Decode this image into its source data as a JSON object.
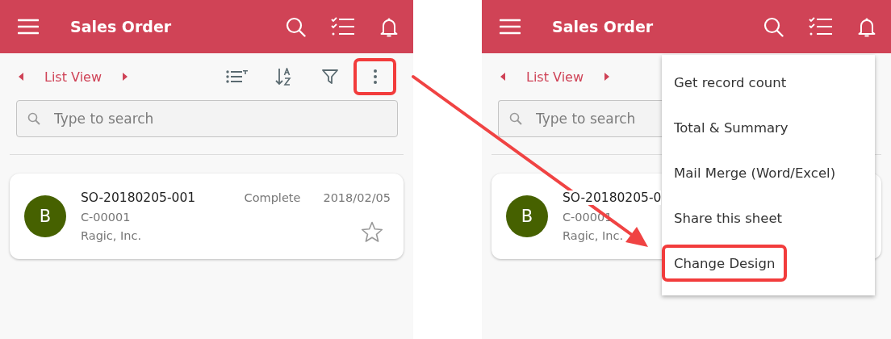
{
  "screens": [
    {
      "header": {
        "title": "Sales Order"
      },
      "view": {
        "label": "List View"
      },
      "more_button": {
        "highlighted": true
      },
      "search": {
        "placeholder": "Type to search"
      },
      "records": [
        {
          "avatar": "B",
          "title": "SO-20180205-001",
          "status": "Complete",
          "date": "2018/02/05",
          "customer_id": "C-00001",
          "company": "Ragic, Inc.",
          "starred": false
        }
      ]
    },
    {
      "header": {
        "title": "Sales Order"
      },
      "view": {
        "label": "List View"
      },
      "search": {
        "placeholder": "Type to search"
      },
      "records": [
        {
          "avatar": "B",
          "title": "SO-20180205-0",
          "customer_id": "C-00001",
          "company": "Ragic, Inc."
        }
      ],
      "menu": {
        "items": [
          {
            "label": "Get record count",
            "highlighted": false
          },
          {
            "label": "Total & Summary",
            "highlighted": false
          },
          {
            "label": "Mail Merge (Word/Excel)",
            "highlighted": false
          },
          {
            "label": "Share this sheet",
            "highlighted": false
          },
          {
            "label": "Change Design",
            "highlighted": true
          }
        ]
      }
    }
  ]
}
